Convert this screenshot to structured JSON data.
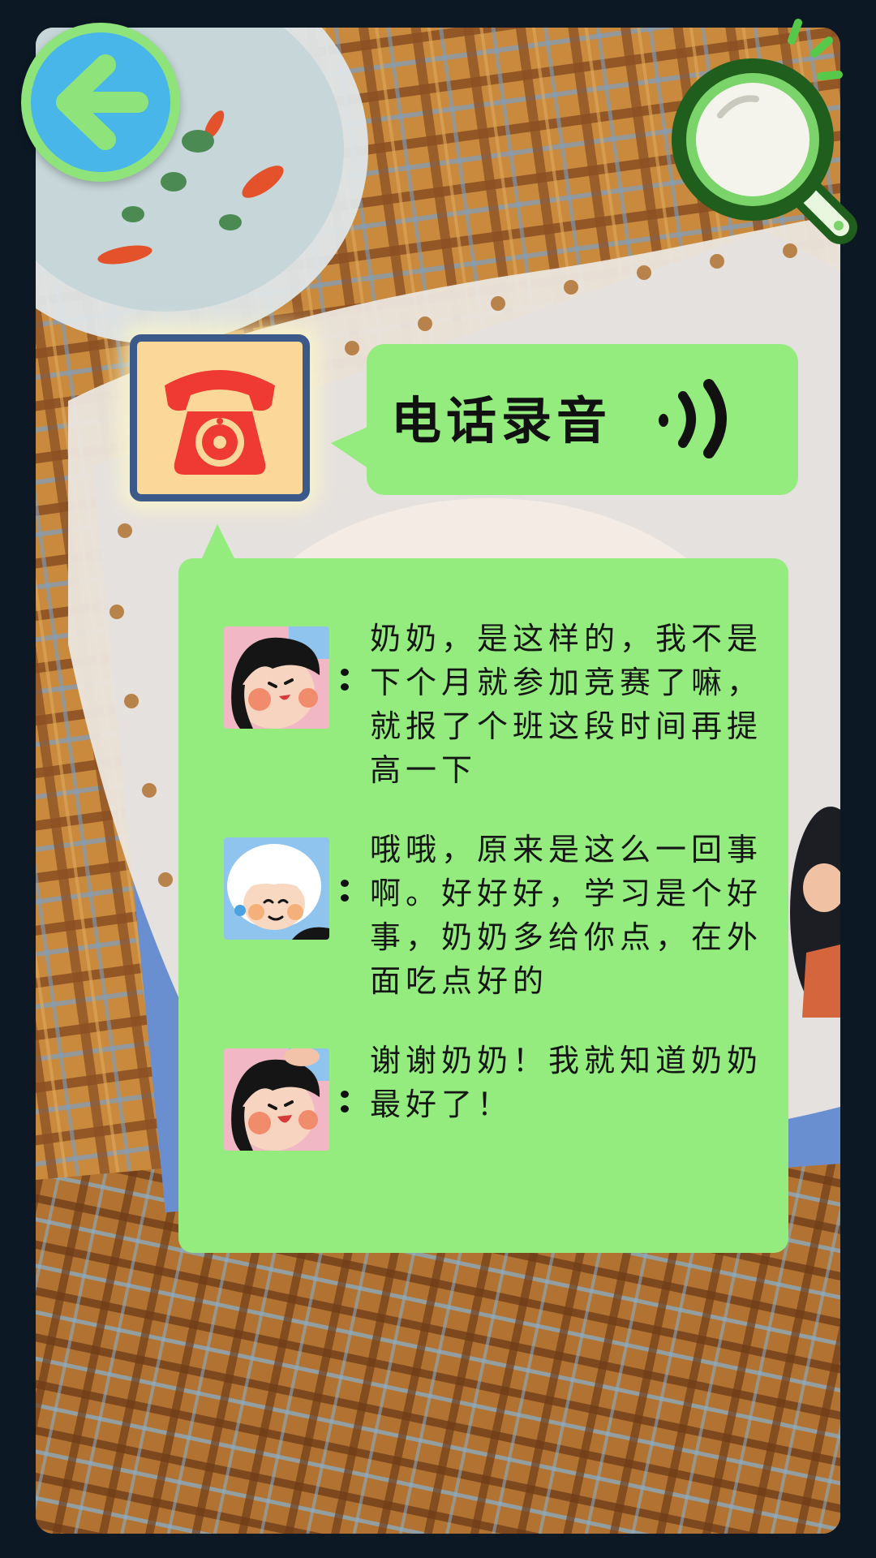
{
  "screen": {
    "background_color": "#0c1824",
    "accent_green": "#93ec7d",
    "back_button_color": "#48b6e8"
  },
  "toolbar": {
    "back_icon": "arrow-left-icon",
    "magnifier_icon": "magnifier-icon"
  },
  "recording": {
    "icon": "telephone-icon",
    "title": "电话录音",
    "sound_icon": "sound-waves-icon"
  },
  "dialogue": [
    {
      "speaker": "girl",
      "avatar_icon": "girl-avatar",
      "text": "奶奶，是这样的，我不是下个月就参加竞赛了嘛，就报了个班这段时间再提高一下"
    },
    {
      "speaker": "grandma",
      "avatar_icon": "grandma-avatar",
      "text": "哦哦，原来是这么一回事啊。好好好，学习是个好事，奶奶多给你点，在外面吃点好的"
    },
    {
      "speaker": "girl",
      "avatar_icon": "girl-avatar",
      "text": "谢谢奶奶！我就知道奶奶最好了！"
    }
  ]
}
